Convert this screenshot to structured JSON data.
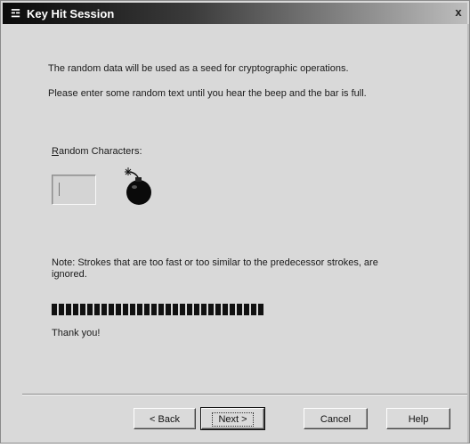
{
  "window": {
    "title": "Key Hit Session",
    "title_icon": "key-tree-icon",
    "close_glyph": "x"
  },
  "content": {
    "para1": "The random data will be used as a seed for cryptographic operations.",
    "para2": "Please enter some random text until you hear the beep and the bar is full.",
    "random_label_accel": "R",
    "random_label_rest": "andom Characters:",
    "random_input_value": "",
    "bomb_icon": "bomb-icon",
    "note": "Note: Strokes that are too fast or too similar to the predecessor strokes, are ignored.",
    "progress_fraction": 1.0,
    "thanks": "Thank you!"
  },
  "buttons": {
    "back": "< Back",
    "next": "Next >",
    "cancel": "Cancel",
    "help": "Help"
  }
}
